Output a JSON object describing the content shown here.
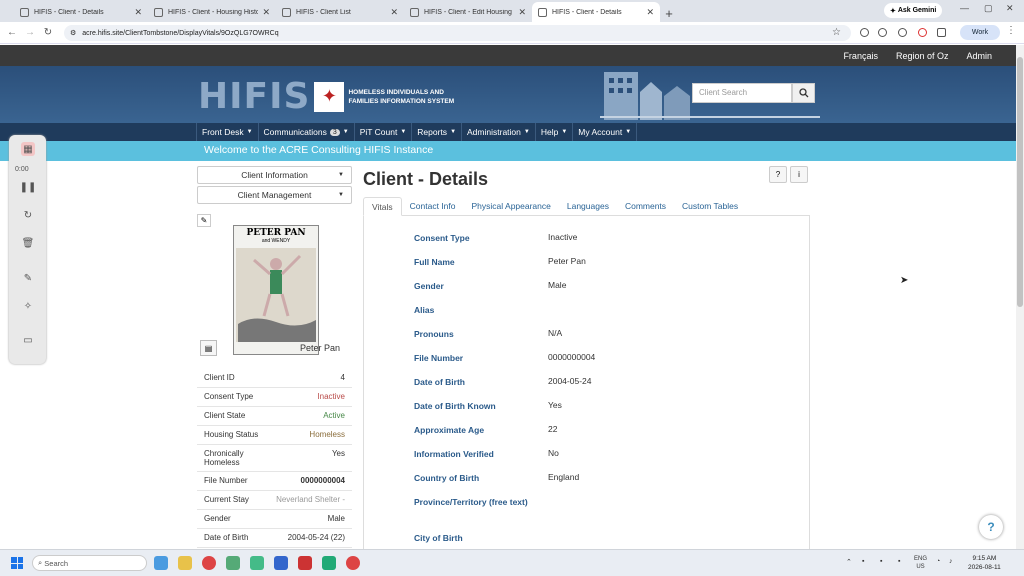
{
  "browser": {
    "tabs": [
      {
        "title": "HIFIS - Client - Details",
        "active": false
      },
      {
        "title": "HIFIS - Client - Housing History",
        "active": false
      },
      {
        "title": "HIFIS - Client List",
        "active": false
      },
      {
        "title": "HIFIS - Client - Edit Housing His",
        "active": false
      },
      {
        "title": "HIFIS - Client - Details",
        "active": true
      }
    ],
    "new_tab": "+",
    "gemini_label": "Ask Gemini",
    "url": "acre.hifis.site/ClientTombstone/DisplayVitals/9OzQLG7OWRCq",
    "profile_label": "Work"
  },
  "topbar": {
    "links": [
      "Français",
      "Region of Oz",
      "Admin"
    ]
  },
  "header": {
    "logo_text": "HIFIS",
    "logo_subtitle": "HOMELESS INDIVIDUALS AND FAMILIES INFORMATION SYSTEM",
    "search_placeholder": "Client Search"
  },
  "nav": {
    "items": [
      {
        "label": "Front Desk",
        "badge": null
      },
      {
        "label": "Communications",
        "badge": "3"
      },
      {
        "label": "PiT Count",
        "badge": null
      },
      {
        "label": "Reports",
        "badge": null
      },
      {
        "label": "Administration",
        "badge": null
      },
      {
        "label": "Help",
        "badge": null
      },
      {
        "label": "My Account",
        "badge": null
      }
    ]
  },
  "welcome": "Welcome to the ACRE Consulting HIFIS Instance",
  "sidebar": {
    "client_information": "Client Information",
    "client_management": "Client Management",
    "photo_title": "PETER PAN",
    "photo_subtitle": "and WENDY",
    "photo_name": "Peter Pan",
    "info": [
      {
        "label": "Client ID",
        "value": "4",
        "style": ""
      },
      {
        "label": "Consent Type",
        "value": "Inactive",
        "style": "red"
      },
      {
        "label": "Client State",
        "value": "Active",
        "style": "green"
      },
      {
        "label": "Housing Status",
        "value": "Homeless",
        "style": "olive"
      },
      {
        "label": "Chronically Homeless",
        "value": "Yes",
        "style": ""
      },
      {
        "label": "File Number",
        "value": "0000000004",
        "style": "bold"
      },
      {
        "label": "Current Stay",
        "value": "Neverland Shelter -",
        "style": "grey"
      },
      {
        "label": "Gender",
        "value": "Male",
        "style": ""
      },
      {
        "label": "Date of Birth",
        "value": "2004-05-24 (22)",
        "style": ""
      }
    ]
  },
  "main": {
    "title": "Client - Details",
    "tabs": [
      "Vitals",
      "Contact Info",
      "Physical Appearance",
      "Languages",
      "Comments",
      "Custom Tables"
    ],
    "fields": [
      {
        "label": "Consent Type",
        "value": "Inactive"
      },
      {
        "label": "Full Name",
        "value": "Peter Pan"
      },
      {
        "label": "Gender",
        "value": "Male"
      },
      {
        "label": "Alias",
        "value": ""
      },
      {
        "label": "Pronouns",
        "value": "N/A"
      },
      {
        "label": "File Number",
        "value": "0000000004"
      },
      {
        "label": "Date of Birth",
        "value": "2004-05-24"
      },
      {
        "label": "Date of Birth Known",
        "value": "Yes"
      },
      {
        "label": "Approximate Age",
        "value": "22"
      },
      {
        "label": "Information Verified",
        "value": "No"
      },
      {
        "label": "Country of Birth",
        "value": "England"
      },
      {
        "label": "Province/Territory (free text)",
        "value": ""
      },
      {
        "label": "City of Birth",
        "value": ""
      }
    ]
  },
  "recorder": {
    "timer": "0:00"
  },
  "taskbar": {
    "search_label": "Search",
    "lang": "ENG",
    "region": "US",
    "time": "9:15 AM",
    "date": "2026-08-11"
  },
  "colors": {
    "nav_bg": "#1f3b5c",
    "welcome_bg": "#5bc0de",
    "label_blue": "#2a5a8a"
  }
}
